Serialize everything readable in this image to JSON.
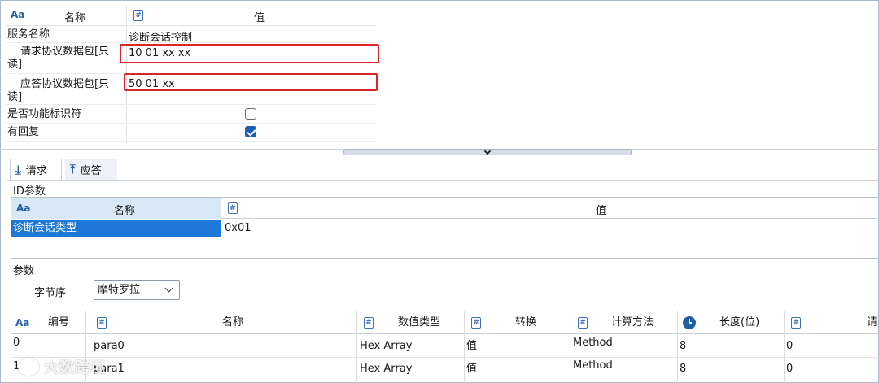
{
  "property_grid": {
    "header_aa": "Aa",
    "header_name": "名称",
    "header_hash": "#",
    "header_value": "值",
    "rows": [
      {
        "name": "服务名称",
        "value": "诊断会话控制"
      },
      {
        "name_line1": "请求协议数据包[只",
        "name_line2": "读]",
        "value": "10 01 xx xx"
      },
      {
        "name_line1": "应答协议数据包[只",
        "name_line2": "读]",
        "value": "50 01 xx"
      },
      {
        "name": "是否功能标识符",
        "checked": false
      },
      {
        "name": "有回复",
        "checked": true
      }
    ]
  },
  "tabs": [
    {
      "icon": "download-arrow-icon",
      "glyph": "⤓",
      "label": "请求",
      "active": true
    },
    {
      "icon": "upload-arrow-icon",
      "glyph": "⤒",
      "label": "应答",
      "active": false
    }
  ],
  "id_params": {
    "group_title": "ID参数",
    "header_aa": "Aa",
    "header_name": "名称",
    "header_hash": "#",
    "header_value": "值",
    "rows": [
      {
        "name": "诊断会话类型",
        "value": "0x01",
        "selected": true
      }
    ]
  },
  "params": {
    "group_title": "参数",
    "byte_order_label": "字节序",
    "byte_order_value": "摩特罗拉",
    "columns": {
      "aa": "Aa",
      "number": "编号",
      "hash": "#",
      "name": "名称",
      "data_type": "数值类型",
      "convert": "转换",
      "calc_method": "计算方法",
      "length": "长度(位)",
      "truncated": "请"
    },
    "rows": [
      {
        "number": "0",
        "name": "para0",
        "data_type": "Hex Array",
        "convert": "值",
        "calc_method": "Method",
        "length": "8",
        "extra": "0"
      },
      {
        "number": "1",
        "name": "para1",
        "data_type": "Hex Array",
        "convert": "值",
        "calc_method": "Method",
        "length": "8",
        "extra": "0"
      }
    ]
  },
  "watermark": {
    "text": "大数跨境"
  },
  "colors": {
    "accent": "#1e78d7",
    "highlight_red": "#d9262b",
    "header_select": "#d8e8f7"
  }
}
